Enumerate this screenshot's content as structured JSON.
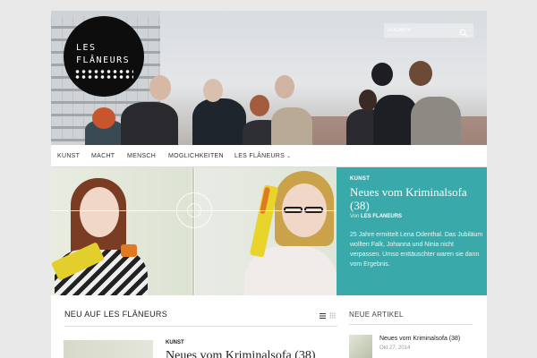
{
  "header": {
    "logo": {
      "line1": "LES",
      "line2": "FLÂNEURS"
    },
    "search": {
      "placeholder": "SUCHEN"
    }
  },
  "nav": {
    "items": [
      {
        "label": "KUNST"
      },
      {
        "label": "MACHT"
      },
      {
        "label": "MENSCH"
      },
      {
        "label": "MOGLICHKEITEN"
      },
      {
        "label": "LES FLÂNEURS",
        "has_dropdown": true
      }
    ]
  },
  "feature": {
    "category": "KUNST",
    "title": "Neues vom Kriminalsofa (38)",
    "by_prefix": "Von",
    "author": "LES FLANEURS",
    "excerpt": "25 Jahre ermittelt Lena Odenthal. Das Jubiläum wollten Falk, Johanna und Ninia nicht verpassen. Umso enttäuschter waren sie dann vom Ergebnis."
  },
  "main": {
    "section_title": "NEU AUF LES FLÂNEURS",
    "view_icons": [
      "list-view-icon",
      "grid-view-icon"
    ],
    "posts": [
      {
        "category": "KUNST",
        "title": "Neues vom Kriminalsofa (38)"
      }
    ]
  },
  "sidebar": {
    "title": "NEUE ARTIKEL",
    "articles": [
      {
        "title": "Neues vom Kriminalsofa (38)",
        "date": "Okt 27, 2014"
      }
    ]
  },
  "colors": {
    "accent": "#3aa9a9",
    "background": "#e9e9e9",
    "logo": "#0d0d0d"
  }
}
